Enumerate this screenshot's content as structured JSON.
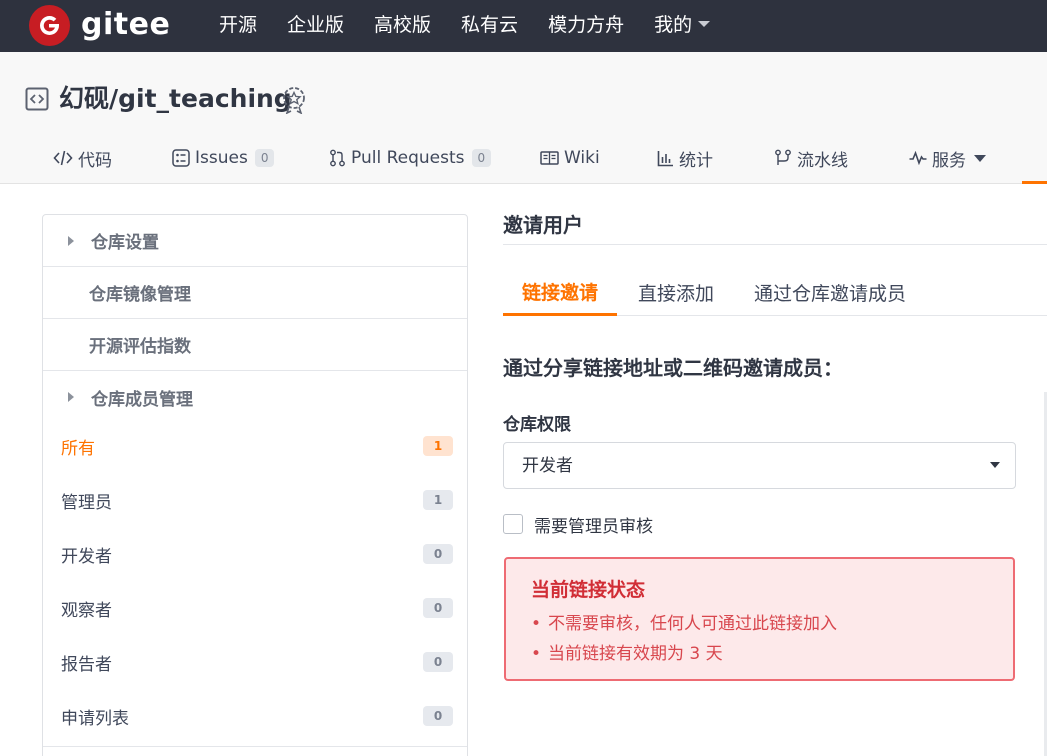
{
  "brand": {
    "name": "gitee",
    "logo_letter": "G",
    "color": "#c71d23"
  },
  "topnav": {
    "items": [
      "开源",
      "企业版",
      "高校版",
      "私有云",
      "模力方舟"
    ],
    "user_menu": "我的"
  },
  "repo": {
    "title": "幻砚/git_teaching",
    "tabs": [
      {
        "label": "代码",
        "icon": "code-icon"
      },
      {
        "label": "Issues",
        "count": "0",
        "icon": "issues-icon"
      },
      {
        "label": "Pull Requests",
        "count": "0",
        "icon": "pull-request-icon"
      },
      {
        "label": "Wiki",
        "icon": "wiki-icon"
      },
      {
        "label": "统计",
        "icon": "stats-icon"
      },
      {
        "label": "流水线",
        "icon": "pipeline-icon"
      },
      {
        "label": "服务",
        "icon": "service-icon"
      }
    ]
  },
  "sidebar": {
    "groups": [
      {
        "label": "仓库设置",
        "collapsible": true
      },
      {
        "label": "仓库镜像管理"
      },
      {
        "label": "开源评估指数"
      },
      {
        "label": "仓库成员管理",
        "collapsible": true
      }
    ],
    "members": [
      {
        "label": "所有",
        "count": "1",
        "active": true
      },
      {
        "label": "管理员",
        "count": "1"
      },
      {
        "label": "开发者",
        "count": "0"
      },
      {
        "label": "观察者",
        "count": "0"
      },
      {
        "label": "报告者",
        "count": "0"
      },
      {
        "label": "申请列表",
        "count": "0"
      }
    ]
  },
  "main": {
    "title": "邀请用户",
    "tabs": [
      "链接邀请",
      "直接添加",
      "通过仓库邀请成员"
    ],
    "heading": "通过分享链接地址或二维码邀请成员：",
    "permission_label": "仓库权限",
    "permission_value": "开发者",
    "require_approval_label": "需要管理员审核",
    "status": {
      "title": "当前链接状态",
      "items": [
        "不需要审核，任何人可通过此链接加入",
        "当前链接有效期为 3 天"
      ]
    }
  },
  "colors": {
    "accent": "#fe7300",
    "topbar": "#2e323e",
    "danger": "#d12e36"
  }
}
